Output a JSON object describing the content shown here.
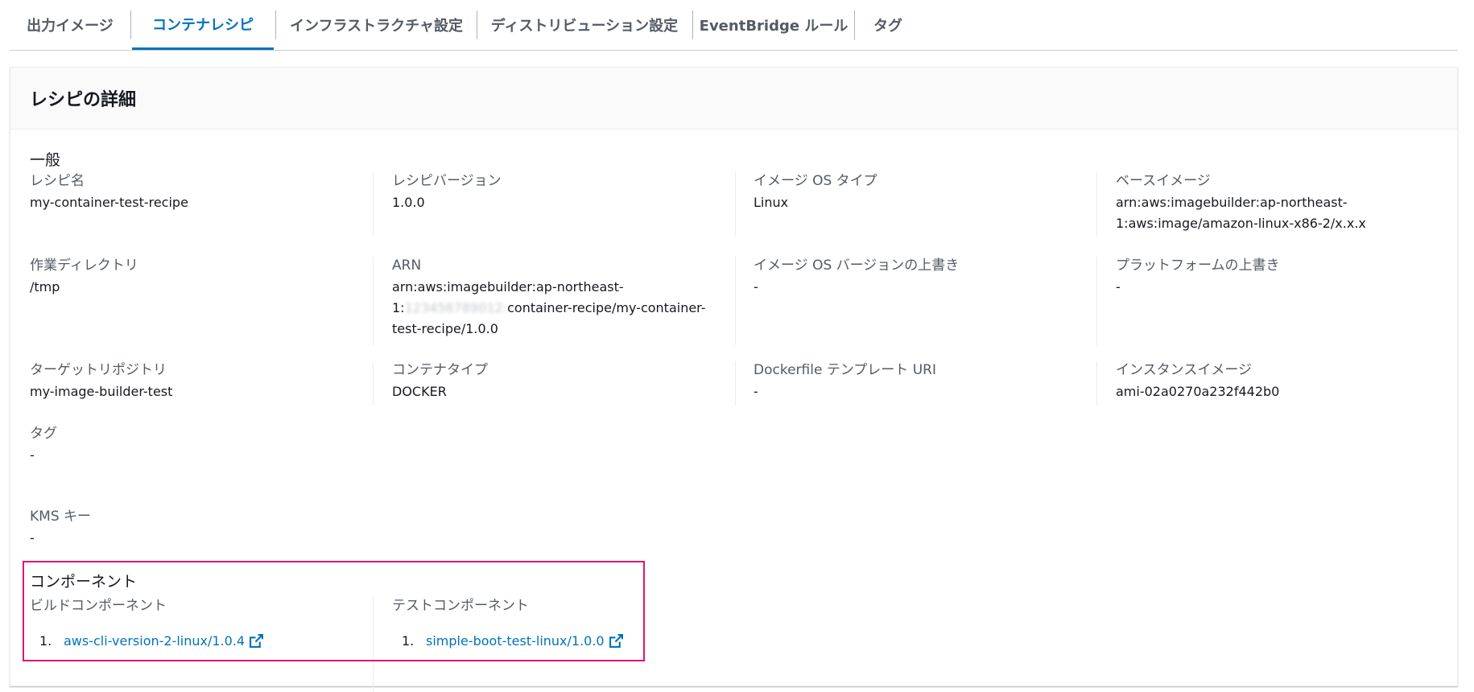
{
  "tabs": [
    {
      "label": "出力イメージ",
      "active": false
    },
    {
      "label": "コンテナレシピ",
      "active": true
    },
    {
      "label": "インフラストラクチャ設定",
      "active": false
    },
    {
      "label": "ディストリビューション設定",
      "active": false
    },
    {
      "label": "EventBridge ルール",
      "active": false
    },
    {
      "label": "タグ",
      "active": false
    }
  ],
  "panel": {
    "title": "レシピの詳細",
    "general_heading": "一般",
    "fields": {
      "recipe_name": {
        "label": "レシピ名",
        "value": "my-container-test-recipe"
      },
      "recipe_version": {
        "label": "レシピバージョン",
        "value": "1.0.0"
      },
      "image_os_type": {
        "label": "イメージ OS タイプ",
        "value": "Linux"
      },
      "base_image": {
        "label": "ベースイメージ",
        "value_line1": "arn:aws:imagebuilder:ap-northeast-",
        "value_line2": "1:aws:image/amazon-linux-x86-2/x.x.x"
      },
      "working_dir": {
        "label": "作業ディレクトリ",
        "value": "/tmp"
      },
      "arn": {
        "label": "ARN",
        "value_line1": "arn:aws:imagebuilder:ap-northeast-",
        "value_line2_prefix": "1:",
        "value_line2_redacted": "123456789012:",
        "value_line2_suffix": "container-recipe/my-container-",
        "value_line3": "test-recipe/1.0.0"
      },
      "os_version_override": {
        "label": "イメージ OS バージョンの上書き",
        "value": "-"
      },
      "platform_override": {
        "label": "プラットフォームの上書き",
        "value": "-"
      },
      "target_repo": {
        "label": "ターゲットリポジトリ",
        "value": "my-image-builder-test"
      },
      "container_type": {
        "label": "コンテナタイプ",
        "value": "DOCKER"
      },
      "dockerfile_uri": {
        "label": "Dockerfile テンプレート URI",
        "value": "-"
      },
      "instance_image": {
        "label": "インスタンスイメージ",
        "value": "ami-02a0270a232f442b0"
      },
      "tags": {
        "label": "タグ",
        "value": "-"
      },
      "kms_key": {
        "label": "KMS キー",
        "value": "-"
      }
    },
    "components": {
      "heading": "コンポーネント",
      "build": {
        "label": "ビルドコンポーネント",
        "items": [
          {
            "num": "1.",
            "name": "aws-cli-version-2-linux/1.0.4"
          }
        ]
      },
      "test": {
        "label": "テストコンポーネント",
        "items": [
          {
            "num": "1.",
            "name": "simple-boot-test-linux/1.0.0"
          }
        ]
      }
    }
  },
  "colors": {
    "link": "#0073bb",
    "highlight": "#e0166e",
    "active_tab": "#0073bb"
  },
  "icons": {
    "external_link": "external-link-icon"
  }
}
